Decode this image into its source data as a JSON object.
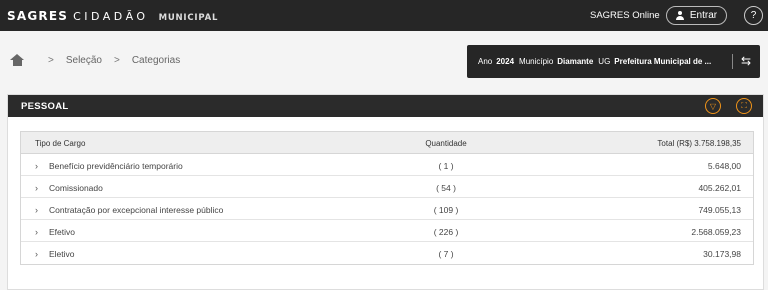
{
  "header": {
    "logo_text": "SAGRES",
    "logo_sub": "CIDADÃO",
    "logo_tag": "MUNICIPAL",
    "online_label": "SAGRES Online",
    "login_label": "Entrar",
    "help_label": "?"
  },
  "breadcrumb": {
    "items": [
      "Seleção",
      "Categorias"
    ],
    "separator": ">"
  },
  "filter": {
    "year_label": "Ano",
    "year_value": "2024",
    "municipality_label": "Município",
    "municipality_value": "Diamante",
    "ug_label": "UG",
    "ug_value": "Prefeitura Municipal de ..."
  },
  "panel": {
    "title": "PESSOAL",
    "accent_color": "#f0941a"
  },
  "table": {
    "columns": [
      "Tipo de Cargo",
      "Quantidade",
      "Total (R$) 3.758.198,35"
    ],
    "rows": [
      {
        "type": "Benefício previdênciário temporário",
        "qty": "( 1 )",
        "total": "5.648,00"
      },
      {
        "type": "Comissionado",
        "qty": "( 54 )",
        "total": "405.262,01"
      },
      {
        "type": "Contratação por excepcional interesse público",
        "qty": "( 109 )",
        "total": "749.055,13"
      },
      {
        "type": "Efetivo",
        "qty": "( 226 )",
        "total": "2.568.059,23"
      },
      {
        "type": "Eletivo",
        "qty": "( 7 )",
        "total": "30.173,98"
      }
    ]
  }
}
